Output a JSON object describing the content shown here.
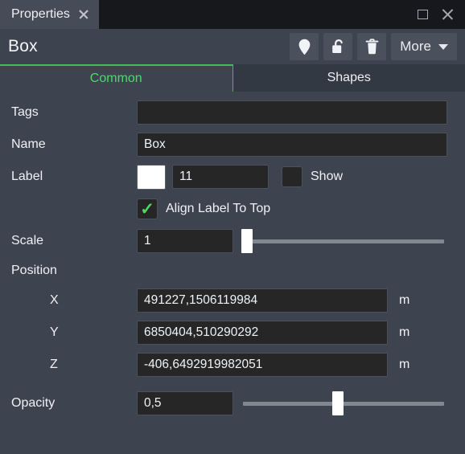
{
  "window": {
    "tab_title": "Properties",
    "close_tab_icon": "close-icon",
    "restore_icon": "restore-window-icon",
    "close_icon": "close-window-icon"
  },
  "header": {
    "object_title": "Box",
    "tools": [
      {
        "name": "map-pin-icon",
        "label": "Pin"
      },
      {
        "name": "unlock-icon",
        "label": "Unlock"
      },
      {
        "name": "trash-icon",
        "label": "Delete"
      }
    ],
    "more_label": "More"
  },
  "tabs": [
    {
      "label": "Common",
      "active": true
    },
    {
      "label": "Shapes",
      "active": false
    }
  ],
  "form": {
    "tags": {
      "label": "Tags",
      "value": "",
      "placeholder": ""
    },
    "name": {
      "label": "Name",
      "value": "Box",
      "placeholder": ""
    },
    "label": {
      "label": "Label",
      "color": "#ffffff",
      "size": "11",
      "show_label": "Show",
      "show_checked": false,
      "align_label": "Align Label To Top",
      "align_checked": true,
      "check_glyph": "✓"
    },
    "scale": {
      "label": "Scale",
      "value": "1",
      "slider_percent": 2
    },
    "position": {
      "label": "Position",
      "axes": [
        {
          "label": "X",
          "value": "491227,1506119984",
          "unit": "m"
        },
        {
          "label": "Y",
          "value": "6850404,510290292",
          "unit": "m"
        },
        {
          "label": "Z",
          "value": "-406,6492919982051",
          "unit": "m"
        }
      ]
    },
    "opacity": {
      "label": "Opacity",
      "value": "0,5",
      "slider_percent": 47
    }
  },
  "colors": {
    "panel_bg": "#3d4450",
    "titlebar_bg": "#16181c",
    "field_bg": "#262626",
    "accent_green": "#4fd86b",
    "tab_inactive_bg": "#323942"
  }
}
